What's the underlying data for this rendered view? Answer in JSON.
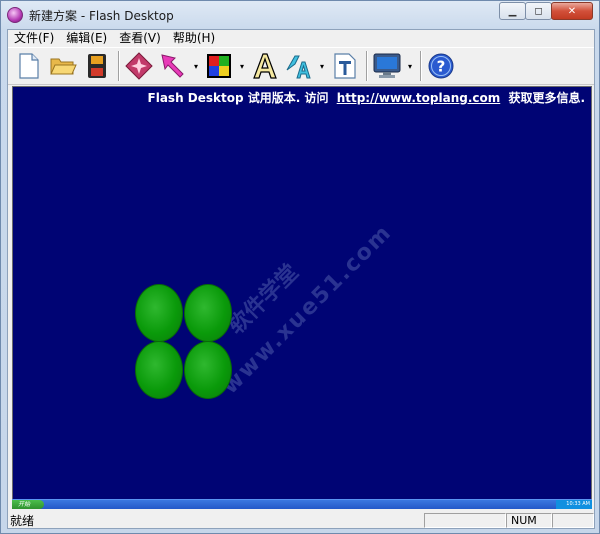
{
  "window": {
    "title": "新建方案 - Flash Desktop",
    "controls": {
      "minimize": "▁",
      "maximize": "◻",
      "close": "✕"
    }
  },
  "menubar": {
    "items": [
      {
        "label": "文件(F)"
      },
      {
        "label": "编辑(E)"
      },
      {
        "label": "查看(V)"
      },
      {
        "label": "帮助(H)"
      }
    ]
  },
  "toolbar": {
    "buttons": [
      {
        "icon": "new-file-icon"
      },
      {
        "icon": "open-folder-icon"
      },
      {
        "icon": "save-disk-icon"
      },
      {
        "icon": "sparkle-effect-icon"
      },
      {
        "icon": "pointer-arrow-icon"
      },
      {
        "icon": "color-palette-icon"
      },
      {
        "icon": "text-font-icon"
      },
      {
        "icon": "text-style-icon"
      },
      {
        "icon": "text-frame-icon"
      },
      {
        "icon": "monitor-preview-icon"
      },
      {
        "icon": "help-icon"
      }
    ],
    "dropdown_glyph": "▾"
  },
  "canvas": {
    "background": "#000474",
    "trial_prefix": "Flash Desktop 试用版本. 访问",
    "trial_link": "http://www.toplang.com",
    "trial_suffix": "获取更多信息.",
    "watermark": "www.xue51.com",
    "watermark_cn": "软件学堂",
    "blob_color": "#0a9a0a"
  },
  "taskbar_preview": {
    "start_label": "开始",
    "clock": "10:33 AM"
  },
  "statusbar": {
    "status_text": "就绪",
    "num_indicator": "NUM"
  }
}
